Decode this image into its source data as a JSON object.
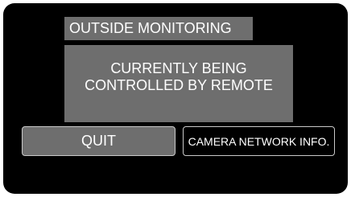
{
  "title": "OUTSIDE MONITORING",
  "message": {
    "line1": "CURRENTLY BEING",
    "line2": "CONTROLLED BY REMOTE"
  },
  "buttons": {
    "quit_label": "QUIT",
    "camera_network_info_label": "CAMERA NETWORK INFO."
  },
  "colors": {
    "screen_background": "#000000",
    "panel_gray": "#6e6e6e",
    "text": "#ffffff"
  }
}
